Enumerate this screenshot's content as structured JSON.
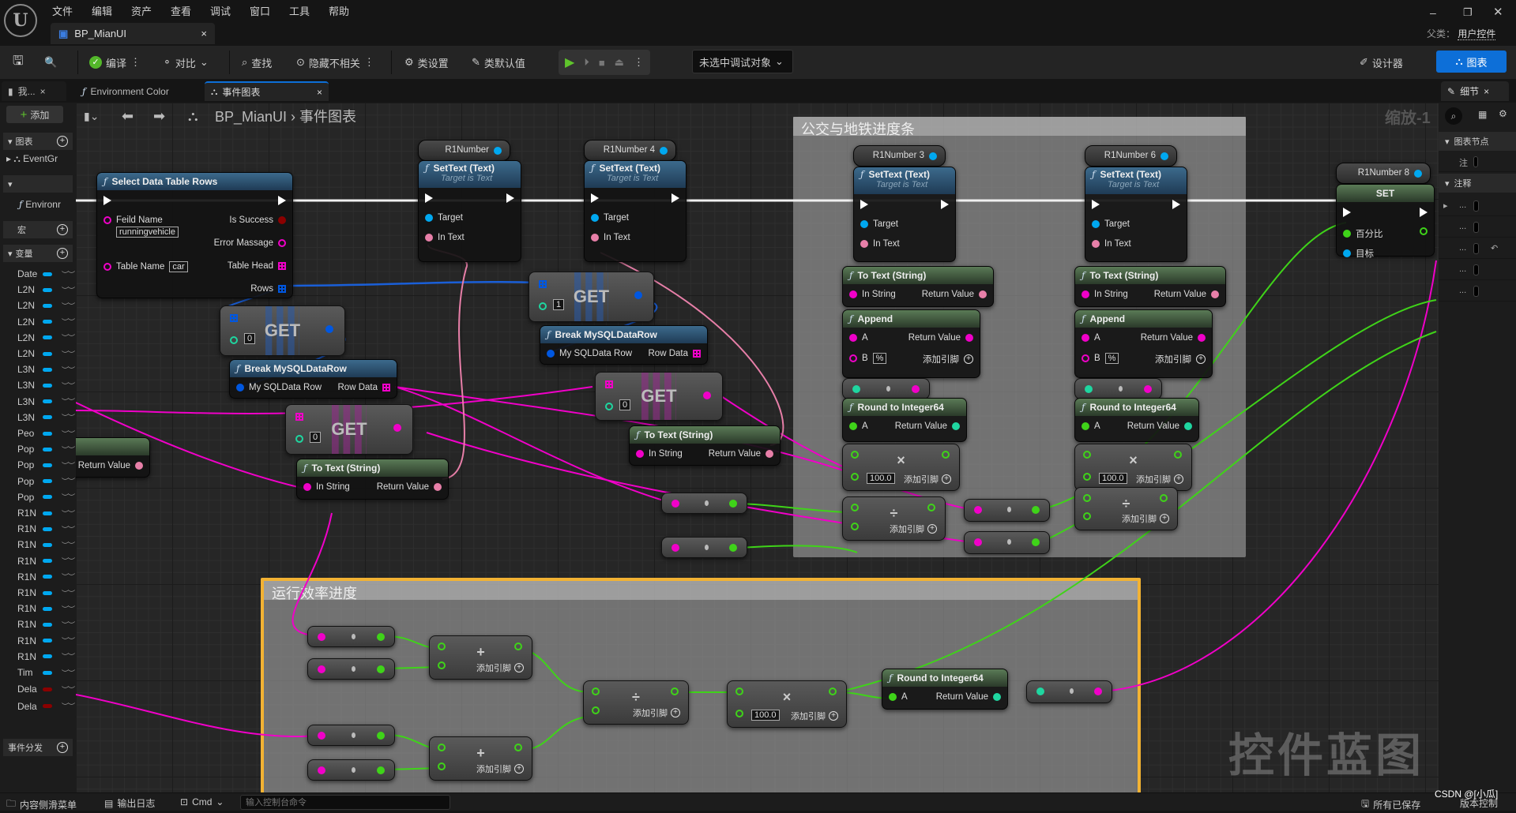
{
  "menu": [
    "文件",
    "编辑",
    "资产",
    "查看",
    "调试",
    "窗口",
    "工具",
    "帮助"
  ],
  "window": {
    "tab": "BP_MianUI",
    "parent_label": "父类：",
    "parent_value": "用户控件"
  },
  "toolbar": {
    "compile": "编译",
    "diff": "对比",
    "find": "查找",
    "hide_unrelated": "隐藏不相关",
    "class_settings": "类设置",
    "class_defaults": "类默认值",
    "debug_target": "未选中调试对象",
    "designer": "设计器",
    "graph": "图表"
  },
  "doc_tabs": [
    {
      "label": "我..."
    },
    {
      "label": "Environment Color"
    },
    {
      "label": "事件图表"
    }
  ],
  "details_tab": "细节",
  "graph_header": {
    "breadcrumb_root": "BP_MianUI",
    "breadcrumb_current": "事件图表",
    "zoom": "缩放-1",
    "watermark": "控件蓝图"
  },
  "left_panel": {
    "add": "添加",
    "graphs": "图表",
    "event_graph": "EventGr",
    "functions_item": "Environr",
    "macros": "宏",
    "variables": "变量",
    "event_dispatchers": "事件分发",
    "vars": [
      {
        "name": "Date",
        "type": "int"
      },
      {
        "name": "L2N",
        "type": "int"
      },
      {
        "name": "L2N",
        "type": "int"
      },
      {
        "name": "L2N",
        "type": "int"
      },
      {
        "name": "L2N",
        "type": "int"
      },
      {
        "name": "L2N",
        "type": "int"
      },
      {
        "name": "L3N",
        "type": "int"
      },
      {
        "name": "L3N",
        "type": "int"
      },
      {
        "name": "L3N",
        "type": "int"
      },
      {
        "name": "L3N",
        "type": "int"
      },
      {
        "name": "Peo",
        "type": "int"
      },
      {
        "name": "Pop",
        "type": "int"
      },
      {
        "name": "Pop",
        "type": "int"
      },
      {
        "name": "Pop",
        "type": "int"
      },
      {
        "name": "Pop",
        "type": "int"
      },
      {
        "name": "R1N",
        "type": "int"
      },
      {
        "name": "R1N",
        "type": "int"
      },
      {
        "name": "R1N",
        "type": "int"
      },
      {
        "name": "R1N",
        "type": "int"
      },
      {
        "name": "R1N",
        "type": "int"
      },
      {
        "name": "R1N",
        "type": "int"
      },
      {
        "name": "R1N",
        "type": "int"
      },
      {
        "name": "R1N",
        "type": "int"
      },
      {
        "name": "R1N",
        "type": "int"
      },
      {
        "name": "R1N",
        "type": "int"
      },
      {
        "name": "Tim",
        "type": "int"
      },
      {
        "name": "Dela",
        "type": "bool"
      },
      {
        "name": "Dela",
        "type": "bool"
      }
    ]
  },
  "right_panel": {
    "section_graph_node": "图表节点",
    "comment_label": "注",
    "section_comment": "注释",
    "rows": [
      "...",
      "...",
      "...",
      "...",
      "..."
    ]
  },
  "comments": [
    {
      "title": "公交与地铁进度条"
    },
    {
      "title": "运行效率进度"
    }
  ],
  "colors": {
    "exec": "#ffffff",
    "object": "#00a8f0",
    "text": "#e77fa8",
    "string": "#f000c8",
    "float": "#3fd319",
    "int": "#1fd6a0",
    "bool": "#8b0000",
    "struct": "#0057e0",
    "accent": "#0d6fd8",
    "comment_border": "#f2b233"
  },
  "nodes": [
    {
      "id": "select",
      "kind": "func",
      "color": "blue",
      "title": "Select Data Table Rows",
      "rows": [
        {
          "l": {
            "t": "exec"
          },
          "r": {
            "t": "exec"
          }
        },
        {
          "l": {
            "label": "Feild Name",
            "t": "string",
            "hollow": true,
            "value": "runningvehicle"
          },
          "r": {
            "label": "Is Success",
            "t": "bool"
          }
        },
        {
          "l": {},
          "r": {
            "label": "Error Massage",
            "t": "string",
            "hollow": true
          }
        },
        {
          "l": {
            "label": "Table Name",
            "t": "string",
            "hollow": true,
            "value": "car"
          },
          "r": {
            "label": "Table Head",
            "t": "string",
            "arr": true
          }
        },
        {
          "l": {},
          "r": {
            "label": "Rows",
            "t": "struct",
            "arr": true
          }
        }
      ]
    },
    {
      "id": "v1",
      "kind": "var",
      "title": "R1Number"
    },
    {
      "id": "st1",
      "kind": "func",
      "color": "blue",
      "title": "SetText (Text)",
      "subtitle": "Target is Text",
      "rows": [
        {
          "l": {
            "t": "exec"
          },
          "r": {
            "t": "exec"
          }
        },
        {
          "l": {
            "label": "Target",
            "t": "object"
          }
        },
        {
          "l": {
            "label": "In Text",
            "t": "text"
          }
        }
      ]
    },
    {
      "id": "v2",
      "kind": "var",
      "title": "R1Number 4"
    },
    {
      "id": "st2",
      "kind": "func",
      "color": "blue",
      "title": "SetText (Text)",
      "subtitle": "Target is Text",
      "rows": [
        {
          "l": {
            "t": "exec"
          },
          "r": {
            "t": "exec"
          }
        },
        {
          "l": {
            "label": "Target",
            "t": "object"
          }
        },
        {
          "l": {
            "label": "In Text",
            "t": "text"
          }
        }
      ]
    },
    {
      "id": "get1",
      "kind": "get",
      "title": "GET",
      "arr_t": "struct",
      "index": "0"
    },
    {
      "id": "br1",
      "kind": "func",
      "color": "blue",
      "title": "Break MySQLDataRow",
      "rows": [
        {
          "l": {
            "label": "My SQLData Row",
            "t": "struct"
          },
          "r": {
            "label": "Row Data",
            "t": "string",
            "arr": true
          }
        }
      ]
    },
    {
      "id": "get2",
      "kind": "get",
      "title": "GET",
      "arr_t": "string",
      "index": "0"
    },
    {
      "id": "tt1",
      "kind": "func",
      "color": "green",
      "title": "To Text (String)",
      "rows": [
        {
          "l": {
            "label": "In String",
            "t": "string"
          },
          "r": {
            "label": "Return Value",
            "t": "text"
          }
        }
      ]
    },
    {
      "id": "get3",
      "kind": "get",
      "title": "GET",
      "arr_t": "struct",
      "index": "1"
    },
    {
      "id": "br2",
      "kind": "func",
      "color": "blue",
      "title": "Break MySQLDataRow",
      "rows": [
        {
          "l": {
            "label": "My SQLData Row",
            "t": "struct"
          },
          "r": {
            "label": "Row Data",
            "t": "string",
            "arr": true
          }
        }
      ]
    },
    {
      "id": "get4",
      "kind": "get",
      "title": "GET",
      "arr_t": "string",
      "index": "0"
    },
    {
      "id": "tt2",
      "kind": "func",
      "color": "green",
      "title": "To Text (String)",
      "rows": [
        {
          "l": {
            "label": "In String",
            "t": "string"
          },
          "r": {
            "label": "Return Value",
            "t": "text"
          }
        }
      ]
    },
    {
      "id": "ttpart",
      "kind": "func",
      "color": "green",
      "title": "g)",
      "rows": [
        {
          "l": {},
          "r": {
            "label": "Return Value",
            "t": "text"
          }
        }
      ]
    },
    {
      "id": "rr1",
      "kind": "reroute",
      "lt": "string",
      "rt": "float"
    },
    {
      "id": "rr2",
      "kind": "reroute",
      "lt": "string",
      "rt": "float"
    },
    {
      "id": "v3",
      "kind": "var",
      "title": "R1Number 3"
    },
    {
      "id": "st3",
      "kind": "func",
      "color": "blue",
      "title": "SetText (Text)",
      "subtitle": "Target is Text",
      "rows": [
        {
          "l": {
            "t": "exec"
          },
          "r": {
            "t": "exec"
          }
        },
        {
          "l": {
            "label": "Target",
            "t": "object"
          }
        },
        {
          "l": {
            "label": "In Text",
            "t": "text"
          }
        }
      ]
    },
    {
      "id": "tt3",
      "kind": "func",
      "color": "green",
      "title": "To Text (String)",
      "rows": [
        {
          "l": {
            "label": "In String",
            "t": "string"
          },
          "r": {
            "label": "Return Value",
            "t": "text"
          }
        }
      ]
    },
    {
      "id": "ap3",
      "kind": "func",
      "color": "green",
      "title": "Append",
      "rows": [
        {
          "l": {
            "label": "A",
            "t": "string"
          },
          "r": {
            "label": "Return Value",
            "t": "string"
          }
        },
        {
          "l": {
            "label": "B",
            "t": "string",
            "hollow": true,
            "value": "%"
          },
          "r": {
            "label": "添加引脚",
            "t": "add"
          }
        }
      ]
    },
    {
      "id": "rr3",
      "kind": "reroute",
      "lt": "int",
      "rt": "string"
    },
    {
      "id": "rd3",
      "kind": "func",
      "color": "green",
      "title": "Round to Integer64",
      "rows": [
        {
          "l": {
            "label": "A",
            "t": "float"
          },
          "r": {
            "label": "Return Value",
            "t": "int"
          }
        }
      ]
    },
    {
      "id": "mul3",
      "kind": "op",
      "sym": "×",
      "value": "100.0",
      "add": "添加引脚"
    },
    {
      "id": "div3",
      "kind": "op",
      "sym": "÷",
      "add": "添加引脚"
    },
    {
      "id": "rr4",
      "kind": "reroute",
      "lt": "string",
      "rt": "float"
    },
    {
      "id": "rr5",
      "kind": "reroute",
      "lt": "string",
      "rt": "float"
    },
    {
      "id": "v6",
      "kind": "var",
      "title": "R1Number 6"
    },
    {
      "id": "st6",
      "kind": "func",
      "color": "blue",
      "title": "SetText (Text)",
      "subtitle": "Target is Text",
      "rows": [
        {
          "l": {
            "t": "exec"
          },
          "r": {
            "t": "exec"
          }
        },
        {
          "l": {
            "label": "Target",
            "t": "object"
          }
        },
        {
          "l": {
            "label": "In Text",
            "t": "text"
          }
        }
      ]
    },
    {
      "id": "tt6",
      "kind": "func",
      "color": "green",
      "title": "To Text (String)",
      "rows": [
        {
          "l": {
            "label": "In String",
            "t": "string"
          },
          "r": {
            "label": "Return Value",
            "t": "text"
          }
        }
      ]
    },
    {
      "id": "ap6",
      "kind": "func",
      "color": "green",
      "title": "Append",
      "rows": [
        {
          "l": {
            "label": "A",
            "t": "string"
          },
          "r": {
            "label": "Return Value",
            "t": "string"
          }
        },
        {
          "l": {
            "label": "B",
            "t": "string",
            "hollow": true,
            "value": "%"
          },
          "r": {
            "label": "添加引脚",
            "t": "add"
          }
        }
      ]
    },
    {
      "id": "rr6",
      "kind": "reroute",
      "lt": "int",
      "rt": "string"
    },
    {
      "id": "rd6",
      "kind": "func",
      "color": "green",
      "title": "Round to Integer64",
      "rows": [
        {
          "l": {
            "label": "A",
            "t": "float"
          },
          "r": {
            "label": "Return Value",
            "t": "int"
          }
        }
      ]
    },
    {
      "id": "mul6",
      "kind": "op",
      "sym": "×",
      "value": "100.0",
      "add": "添加引脚"
    },
    {
      "id": "div6",
      "kind": "op",
      "sym": "÷",
      "add": "添加引脚"
    },
    {
      "id": "v8",
      "kind": "var",
      "title": "R1Number 8"
    },
    {
      "id": "set8",
      "kind": "func",
      "color": "green",
      "title": "SET",
      "center": true,
      "rows": [
        {
          "l": {
            "t": "exec"
          },
          "r": {
            "t": "exec"
          }
        },
        {
          "l": {
            "label": "百分比",
            "t": "float"
          },
          "r": {
            "t": "float",
            "hollow": true
          }
        },
        {
          "l": {
            "label": "目标",
            "t": "object"
          }
        }
      ]
    },
    {
      "id": "rra",
      "kind": "reroute",
      "lt": "string",
      "rt": "float"
    },
    {
      "id": "rrb",
      "kind": "reroute",
      "lt": "string",
      "rt": "float"
    },
    {
      "id": "rrc",
      "kind": "reroute",
      "lt": "string",
      "rt": "float"
    },
    {
      "id": "rrd",
      "kind": "reroute",
      "lt": "string",
      "rt": "float"
    },
    {
      "id": "adda",
      "kind": "op",
      "sym": "+",
      "add": "添加引脚"
    },
    {
      "id": "addb",
      "kind": "op",
      "sym": "+",
      "add": "添加引脚"
    },
    {
      "id": "divc",
      "kind": "op",
      "sym": "÷",
      "add": "添加引脚"
    },
    {
      "id": "mulc",
      "kind": "op",
      "sym": "×",
      "value": "100.0",
      "add": "添加引脚"
    },
    {
      "id": "rdc",
      "kind": "func",
      "color": "green",
      "title": "Round to Integer64",
      "rows": [
        {
          "l": {
            "label": "A",
            "t": "float"
          },
          "r": {
            "label": "Return Value",
            "t": "int"
          }
        }
      ]
    },
    {
      "id": "rre",
      "kind": "reroute",
      "lt": "int",
      "rt": "string"
    }
  ],
  "status_bar": {
    "content_drawer": "内容侧滑菜单",
    "output_log": "输出日志",
    "cmd": "Cmd",
    "console_placeholder": "输入控制台命令",
    "all_saved": "所有已保存",
    "source_control": "版本控制",
    "csdn": "CSDN @[小瓜]"
  }
}
